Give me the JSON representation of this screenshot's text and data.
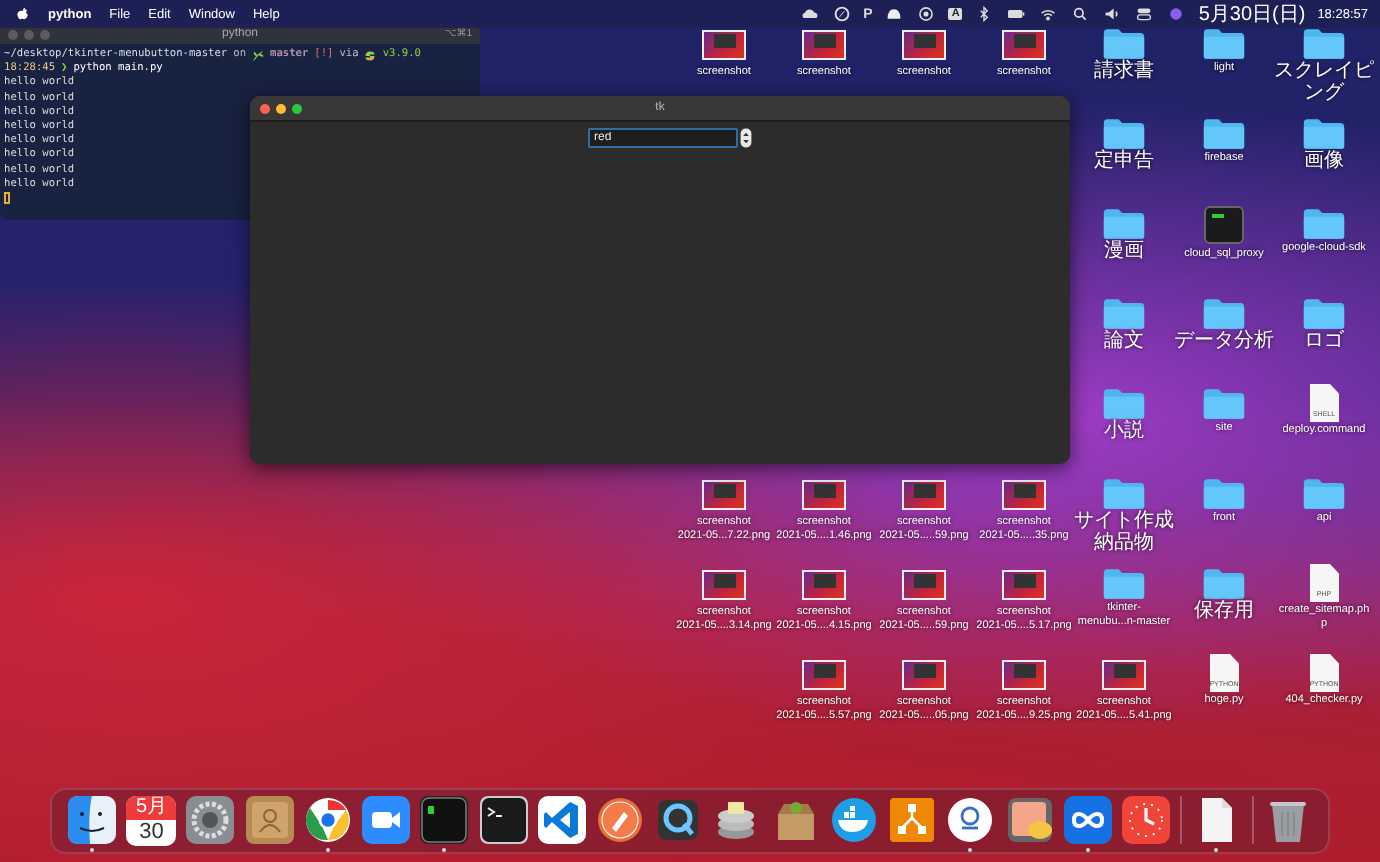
{
  "menubar": {
    "app": "python",
    "menus": [
      "File",
      "Edit",
      "Window",
      "Help"
    ],
    "status": [
      {
        "kind": "cloud"
      },
      {
        "kind": "compass"
      },
      {
        "kind": "letter",
        "text": "P"
      },
      {
        "kind": "hat"
      },
      {
        "kind": "record"
      },
      {
        "kind": "letter_box",
        "text": "A"
      },
      {
        "kind": "bluetooth"
      },
      {
        "kind": "battery"
      },
      {
        "kind": "wifi"
      },
      {
        "kind": "search"
      },
      {
        "kind": "speaker"
      },
      {
        "kind": "control"
      },
      {
        "kind": "siri"
      }
    ],
    "date": "5月30日(日)",
    "time": "18:28:57"
  },
  "terminal": {
    "title": "python",
    "shortcut": "⌥⌘1",
    "prompt": {
      "path": "~/desktop/tkinter-menubutton-master",
      "on": "on",
      "branch": "master",
      "status": "[!]",
      "via": "via",
      "version": "v3.9.0"
    },
    "command_line": {
      "time": "18:28:45",
      "arrow": "❯",
      "command": "python main.py"
    },
    "output": [
      "hello world",
      "hello world",
      "hello world",
      "hello world",
      "hello world",
      "hello world",
      "hello world",
      "hello world"
    ]
  },
  "tk_window": {
    "title": "tk",
    "spinbox": {
      "value": "red"
    }
  },
  "desktop": {
    "top_row": [
      {
        "kind": "screenshot",
        "label": "screenshot"
      },
      {
        "kind": "screenshot",
        "label": "screenshot"
      },
      {
        "kind": "screenshot",
        "label": "screenshot"
      },
      {
        "kind": "screenshot",
        "label": "screenshot"
      }
    ],
    "columns": [
      [
        {
          "kind": "folder",
          "label": "請求書"
        },
        {
          "kind": "folder",
          "label": "定申告"
        },
        {
          "kind": "folder",
          "label": "漫画"
        },
        {
          "kind": "folder",
          "label": "論文"
        },
        {
          "kind": "folder",
          "label": "小説"
        },
        {
          "kind": "folder",
          "label": "サイト作成納品物"
        },
        {
          "kind": "folder",
          "label": "tkinter-\nmenubu...n-master"
        },
        {
          "kind": "screenshot",
          "label": "screenshot\n2021-05....5.41.png"
        }
      ],
      [
        {
          "kind": "folder",
          "label": "light"
        },
        {
          "kind": "folder",
          "label": "firebase"
        },
        {
          "kind": "executable",
          "label": "cloud_sql_proxy"
        },
        {
          "kind": "folder",
          "label": "データ分析"
        },
        {
          "kind": "folder",
          "label": "site"
        },
        {
          "kind": "folder",
          "label": "front"
        },
        {
          "kind": "folder",
          "label": "保存用"
        },
        {
          "kind": "document",
          "label": "hoge.py",
          "tag": "PYTHON"
        }
      ],
      [
        {
          "kind": "folder",
          "label": "スクレイピング"
        },
        {
          "kind": "folder",
          "label": "画像"
        },
        {
          "kind": "folder",
          "label": "google-cloud-sdk"
        },
        {
          "kind": "folder",
          "label": "ロゴ"
        },
        {
          "kind": "document",
          "label": "deploy.command",
          "tag": "SHELL"
        },
        {
          "kind": "folder",
          "label": "api"
        },
        {
          "kind": "document",
          "label": "create_sitemap.ph\np",
          "tag": "PHP"
        },
        {
          "kind": "document",
          "label": "404_checker.py",
          "tag": "PYTHON"
        }
      ]
    ],
    "bottom_rows": [
      [
        {
          "kind": "screenshot",
          "label": "screenshot\n2021-05...7.22.png"
        },
        {
          "kind": "screenshot",
          "label": "screenshot\n2021-05....1.46.png"
        },
        {
          "kind": "screenshot",
          "label": "screenshot\n2021-05.....59.png"
        },
        {
          "kind": "screenshot",
          "label": "screenshot\n2021-05.....35.png"
        }
      ],
      [
        {
          "kind": "screenshot",
          "label": "screenshot\n2021-05....3.14.png"
        },
        {
          "kind": "screenshot",
          "label": "screenshot\n2021-05....4.15.png"
        },
        {
          "kind": "screenshot",
          "label": "screenshot\n2021-05.....59.png"
        },
        {
          "kind": "screenshot",
          "label": "screenshot\n2021-05....5.17.png"
        }
      ],
      [
        {
          "kind": "screenshot",
          "label": "screenshot\n2021-05....5.57.png"
        },
        {
          "kind": "screenshot",
          "label": "screenshot\n2021-05.....05.png"
        },
        {
          "kind": "screenshot",
          "label": "screenshot\n2021-05....9.25.png"
        }
      ]
    ]
  },
  "dock": {
    "apps": [
      {
        "kind": "finder",
        "running": true
      },
      {
        "kind": "calendar",
        "running": false,
        "month": "5月",
        "day": "30"
      },
      {
        "kind": "settings",
        "running": false
      },
      {
        "kind": "contacts",
        "running": false
      },
      {
        "kind": "browser",
        "running": true
      },
      {
        "kind": "video",
        "running": false
      },
      {
        "kind": "terminal",
        "running": true
      },
      {
        "kind": "shell",
        "running": false
      },
      {
        "kind": "code_editor",
        "running": false
      },
      {
        "kind": "rocket",
        "running": false
      },
      {
        "kind": "player",
        "running": false
      },
      {
        "kind": "database",
        "running": false
      },
      {
        "kind": "archive",
        "running": false
      },
      {
        "kind": "whale",
        "running": false
      },
      {
        "kind": "diagram",
        "running": false
      },
      {
        "kind": "ring",
        "running": true
      },
      {
        "kind": "preview",
        "running": false
      },
      {
        "kind": "infinity",
        "running": true
      },
      {
        "kind": "clock",
        "running": false
      }
    ],
    "documents": [
      {
        "kind": "document",
        "running": true
      }
    ],
    "trash": {
      "kind": "trash",
      "running": false
    }
  }
}
